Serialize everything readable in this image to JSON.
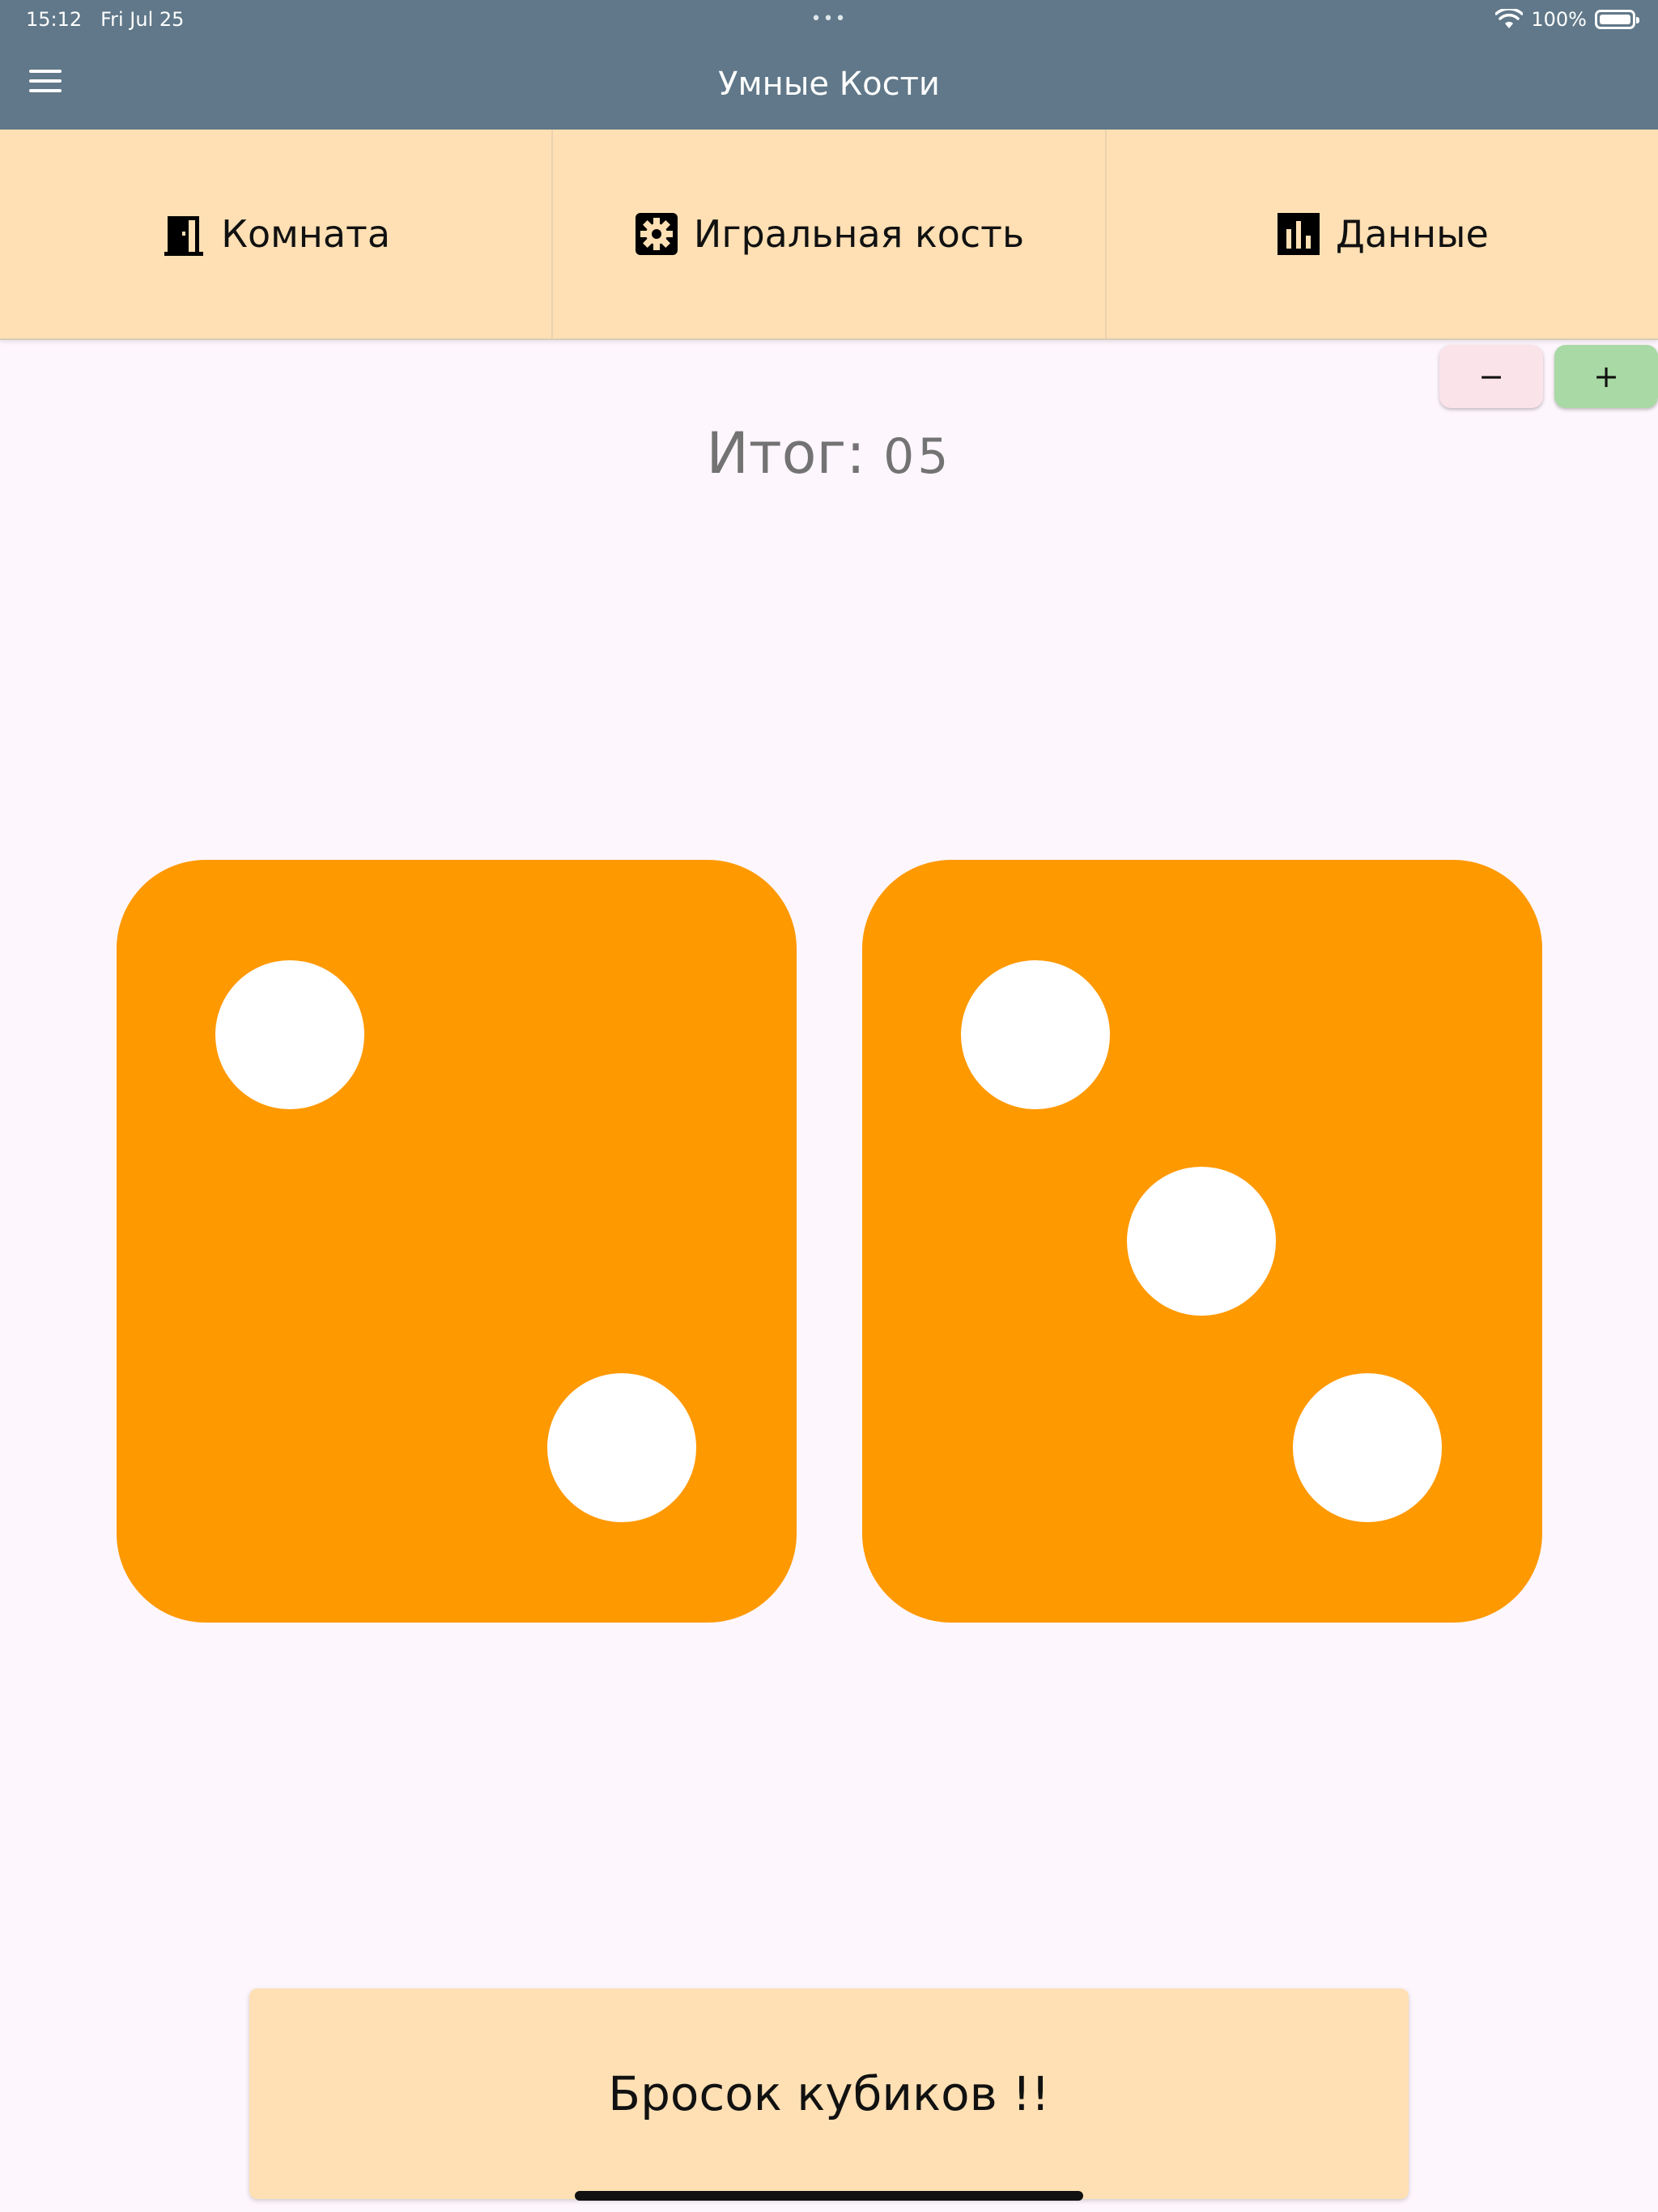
{
  "status_bar": {
    "time": "15:12",
    "date": "Fri Jul 25",
    "battery": "100%"
  },
  "header": {
    "title": "Умные Кости",
    "menu_icon": "hamburger-menu-icon"
  },
  "tabs": [
    {
      "label": "Комната",
      "icon": "door-icon"
    },
    {
      "label": "Игральная кость",
      "icon": "gear-icon"
    },
    {
      "label": "Данные",
      "icon": "bar-chart-icon"
    }
  ],
  "stepper": {
    "minus_label": "−",
    "plus_label": "+"
  },
  "total": {
    "label": "Итог:",
    "value": "05"
  },
  "dice": [
    {
      "value": 2
    },
    {
      "value": 3
    }
  ],
  "colors": {
    "appbar": "#607889",
    "tab_bg": "#ffe0b4",
    "die": "#ff9900",
    "pip": "#ffffff",
    "minus_bg": "#fbe3ea",
    "plus_bg": "#a9d9a5"
  },
  "roll_button": {
    "label": "Бросок кубиков !!"
  }
}
